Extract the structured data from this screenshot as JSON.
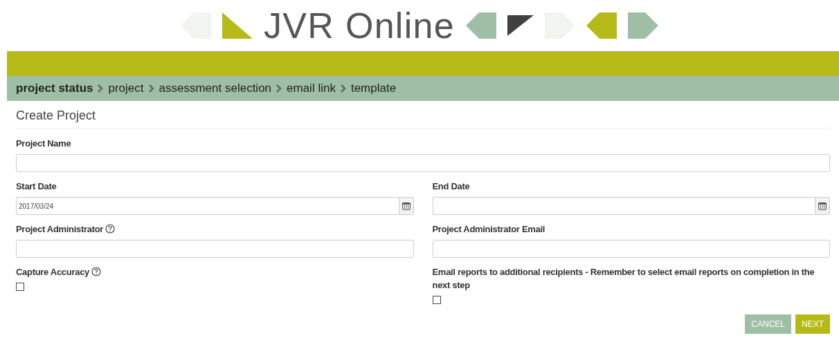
{
  "logo": {
    "text": "JVR Online"
  },
  "breadcrumb": [
    {
      "label": "project status",
      "selected": true
    },
    {
      "label": "project",
      "selected": false
    },
    {
      "label": "assessment selection",
      "selected": false
    },
    {
      "label": "email link",
      "selected": false
    },
    {
      "label": "template",
      "selected": false
    }
  ],
  "form": {
    "title": "Create Project",
    "rows": [
      [
        {
          "kind": "text",
          "label": "Project Name"
        }
      ],
      [
        {
          "kind": "date",
          "label": "Start Date",
          "value": "2017/03/24"
        },
        {
          "kind": "date",
          "label": "End Date"
        }
      ],
      [
        {
          "kind": "text",
          "label": "Project Administrator",
          "help": true
        },
        {
          "kind": "text",
          "label": "Project Administrator Email"
        }
      ],
      [
        {
          "kind": "checkbox",
          "label": "Capture Accuracy",
          "help": true,
          "checked": false
        },
        {
          "kind": "checkbox",
          "label": "Email reports to additional recipients - Remember to select email reports on completion in the next step",
          "checked": false
        }
      ]
    ]
  },
  "buttons": [
    {
      "kind": "secondary",
      "label": "CANCEL"
    },
    {
      "kind": "primary",
      "label": "NEXT"
    }
  ]
}
